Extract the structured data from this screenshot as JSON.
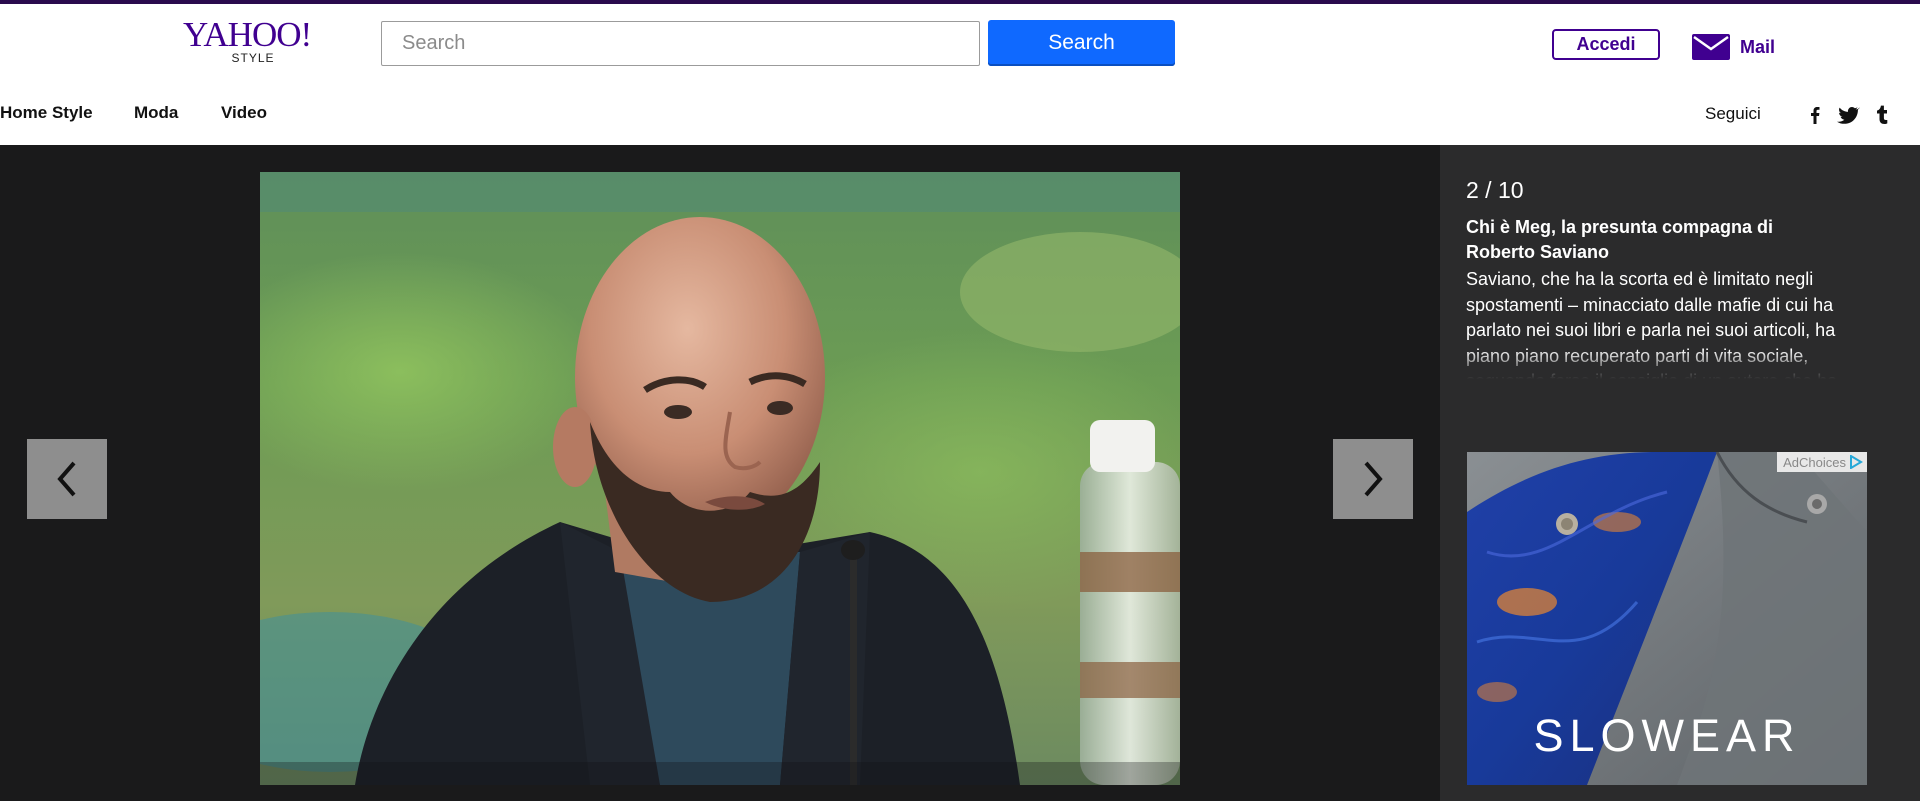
{
  "header": {
    "logo_text": "YAHOO!",
    "logo_sub": "STYLE",
    "search_placeholder": "Search",
    "search_button": "Search",
    "signin_label": "Accedi",
    "mail_label": "Mail"
  },
  "nav": {
    "items": [
      {
        "label": "Home Style"
      },
      {
        "label": "Moda"
      },
      {
        "label": "Video"
      }
    ],
    "follow_label": "Seguici",
    "social_icons": [
      "facebook-icon",
      "twitter-icon",
      "tumblr-icon"
    ]
  },
  "gallery": {
    "counter": "2 / 10",
    "title": "Chi è Meg, la presunta compagna di Roberto Saviano",
    "description": "Saviano, che ha la scorta ed è limitato negli spostamenti – minacciato dalle mafie di cui ha parlato nei suoi libri e parla nei suoi articoli, ha piano piano recuperato parti di vita sociale, seguendo forse il consiglio di un autore che ha condiviso con lui lo stesso destino da isolato:",
    "prev_icon": "chevron-left-icon",
    "next_icon": "chevron-right-icon"
  },
  "ad": {
    "adchoices_label": "AdChoices",
    "brand": "SLOWEAR"
  },
  "colors": {
    "brand_purple": "#400090",
    "search_blue": "#0f69ff",
    "stage_bg": "#1a1a1b",
    "sidebar_bg": "#2b2b2c"
  }
}
